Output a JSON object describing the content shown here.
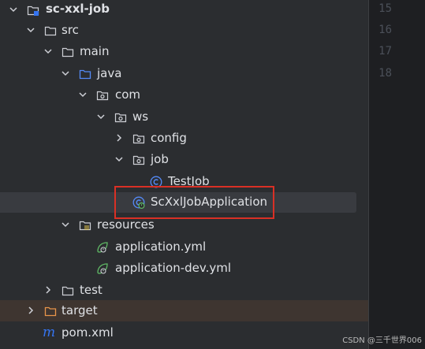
{
  "tree": {
    "root_label": "sc-xxl-job",
    "src_label": "src",
    "main_label": "main",
    "java_label": "java",
    "com_label": "com",
    "ws_label": "ws",
    "config_label": "config",
    "job_label": "job",
    "testjob_label": "TestJob",
    "app_label": "ScXxlJobApplication",
    "resources_label": "resources",
    "app_yml_label": "application.yml",
    "app_dev_yml_label": "application-dev.yml",
    "test_label": "test",
    "target_label": "target",
    "pom_label": "pom.xml"
  },
  "editor": {
    "line_numbers": [
      "15",
      "16",
      "17",
      "18"
    ]
  },
  "watermark": "CSDN @三千世界006",
  "colors": {
    "background": "#2b2d30",
    "selected_row": "#393b40",
    "excluded_row": "#3e3530",
    "annotation": "#d93025",
    "folder_stroke": "#ced0d6",
    "java_folder": "#548af7",
    "class_icon": "#548af7",
    "spring_leaf": "#5fb865",
    "target_folder": "#e8954a",
    "maven_icon": "#3574f0"
  }
}
